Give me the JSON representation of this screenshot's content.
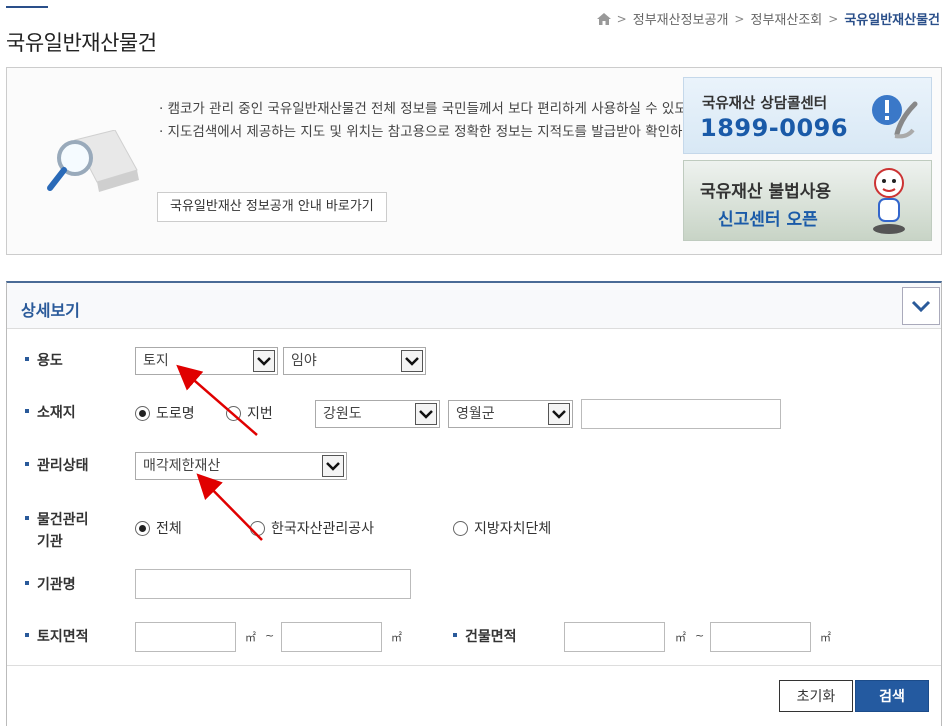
{
  "header": {
    "title": "국유일반재산물건",
    "breadcrumb": [
      "정부재산정보공개",
      "정부재산조회",
      "국유일반재산물건"
    ]
  },
  "info": {
    "notice_1": "캠코가 관리 중인 국유일반재산물건 전체 정보를 국민들께서 보다 편리하게 사용하실 수 있도록 온비드를 통해 공개하고 있습니다.",
    "notice_2": "지도검색에서 제공하는 지도 및 위치는 참고용으로 정확한 정보는 지적도를 발급받아 확인하시기 바랍니다.",
    "guide_button": "국유일반재산 정보공개 안내 바로가기",
    "banner_call_title": "국유재산 상담콜센터",
    "banner_call_phone": "1899-0096",
    "banner_report_line1": "국유재산 불법사용",
    "banner_report_line2": "신고센터 오픈"
  },
  "panel": {
    "title": "상세보기",
    "labels": {
      "usage": "용도",
      "location": "소재지",
      "status": "관리상태",
      "agency_line1": "물건관리",
      "agency_line2": "기관",
      "agency_name": "기관명",
      "land_area": "토지면적",
      "building_area": "건물면적"
    },
    "usage_select_1": "토지",
    "usage_select_2": "임야",
    "location_radio_road": "도로명",
    "location_radio_lot": "지번",
    "location_province": "강원도",
    "location_county": "영월군",
    "status_select": "매각제한재산",
    "agency_radio_all": "전체",
    "agency_radio_kamco": "한국자산관리공사",
    "agency_radio_local": "지방자치단체",
    "unit_m2": "㎡",
    "tilde": "~",
    "reset_button": "초기화",
    "search_button": "검색"
  },
  "colors": {
    "accent": "#245aa0",
    "title_blue": "#2a5a9a",
    "annotation_arrow": "#e00000"
  }
}
